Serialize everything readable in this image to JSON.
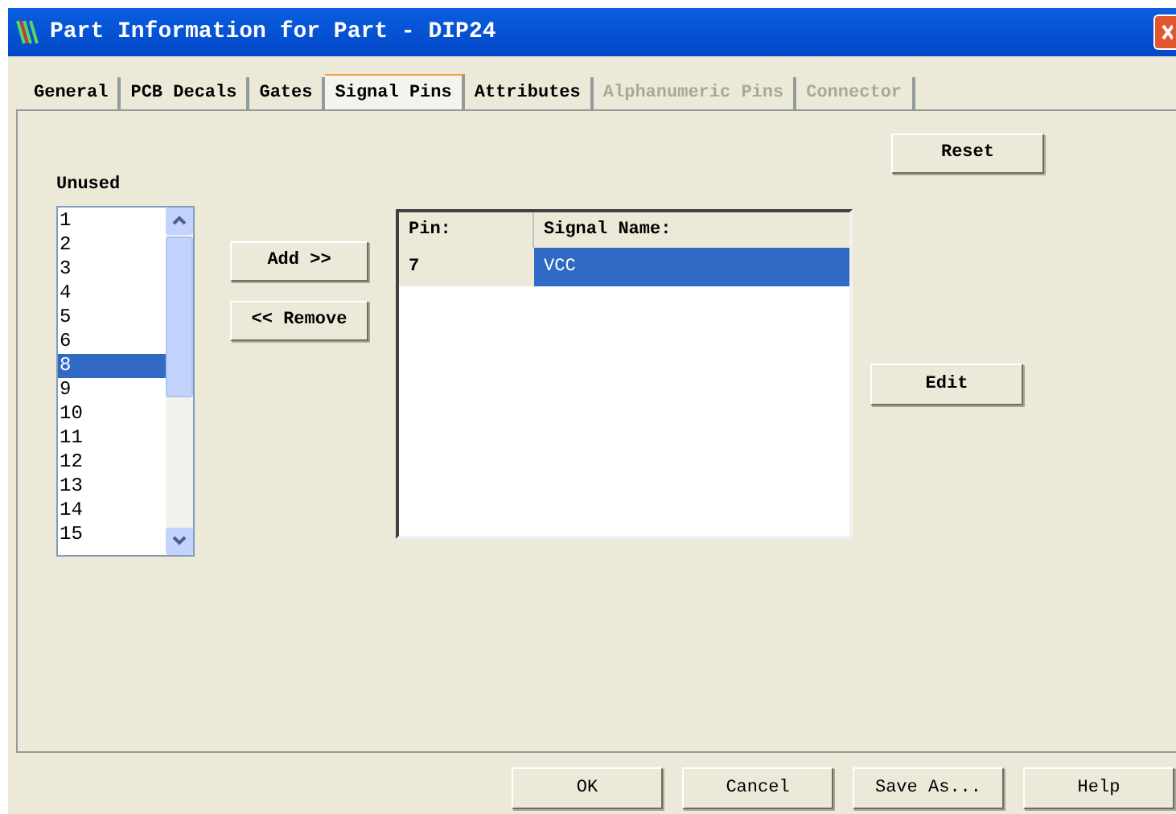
{
  "window": {
    "title": "Part Information for Part - DIP24"
  },
  "tabs": [
    {
      "label": "General",
      "selected": false,
      "disabled": false
    },
    {
      "label": "PCB Decals",
      "selected": false,
      "disabled": false
    },
    {
      "label": "Gates",
      "selected": false,
      "disabled": false
    },
    {
      "label": "Signal Pins",
      "selected": true,
      "disabled": false
    },
    {
      "label": "Attributes",
      "selected": false,
      "disabled": false
    },
    {
      "label": "Alphanumeric Pins",
      "selected": false,
      "disabled": true
    },
    {
      "label": "Connector",
      "selected": false,
      "disabled": true
    }
  ],
  "unused": {
    "label": "Unused",
    "items": [
      {
        "text": "1",
        "selected": false
      },
      {
        "text": "2",
        "selected": false
      },
      {
        "text": "3",
        "selected": false
      },
      {
        "text": "4",
        "selected": false
      },
      {
        "text": "5",
        "selected": false
      },
      {
        "text": "6",
        "selected": false
      },
      {
        "text": "8",
        "selected": true
      },
      {
        "text": "9",
        "selected": false
      },
      {
        "text": "10",
        "selected": false
      },
      {
        "text": "11",
        "selected": false
      },
      {
        "text": "12",
        "selected": false
      },
      {
        "text": "13",
        "selected": false
      },
      {
        "text": "14",
        "selected": false
      },
      {
        "text": "15",
        "selected": false
      }
    ]
  },
  "move_buttons": [
    "Add >>",
    "<< Remove"
  ],
  "table": {
    "columns": [
      "Pin:",
      "Signal Name:"
    ],
    "rows": [
      {
        "pin": "7",
        "signal": "VCC",
        "selected": true
      }
    ]
  },
  "reset_button": "Reset",
  "edit_button": "Edit",
  "footer_buttons": [
    "OK",
    "Cancel",
    "Save As...",
    "Help"
  ]
}
